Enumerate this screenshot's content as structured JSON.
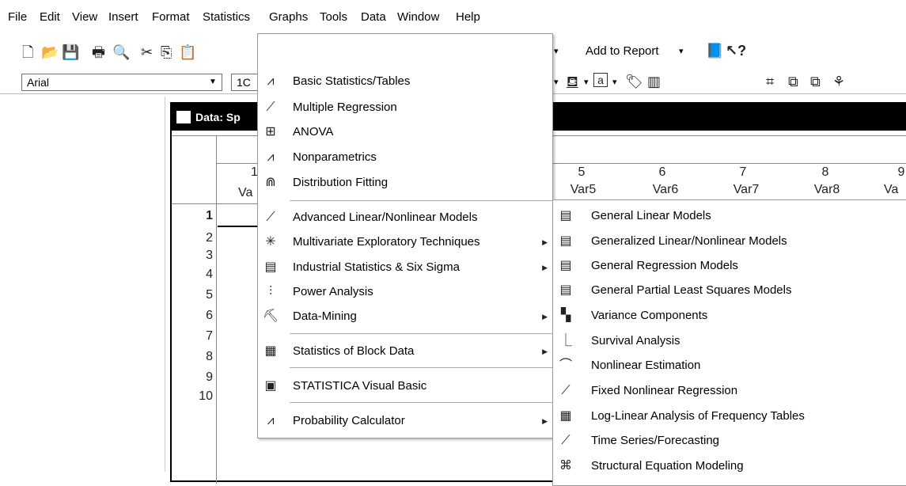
{
  "menubar": [
    "File",
    "Edit",
    "View",
    "Insert",
    "Format",
    "Statistics",
    "Graphs",
    "Tools",
    "Data",
    "Window",
    "Help"
  ],
  "toolbar": {
    "add_to_report": "Add to Report",
    "font_name": "Arial",
    "font_size": "1C"
  },
  "data_window": {
    "title": "Data: Sp",
    "col_first_header": "Va",
    "col_first_num": "1",
    "columns": [
      {
        "num": "5",
        "name": "Var5"
      },
      {
        "num": "6",
        "name": "Var6"
      },
      {
        "num": "7",
        "name": "Var7"
      },
      {
        "num": "8",
        "name": "Var8"
      },
      {
        "num": "9",
        "name": "Va"
      }
    ],
    "rows": [
      "1",
      "2",
      "3",
      "4",
      "5",
      "6",
      "7",
      "8",
      "9",
      "10"
    ]
  },
  "statistics_menu": [
    {
      "label": "Basic Statistics/Tables",
      "icon": "basic-stats-icon",
      "submenu": false
    },
    {
      "label": "Multiple Regression",
      "icon": "regression-icon",
      "submenu": false
    },
    {
      "label": "ANOVA",
      "icon": "anova-icon",
      "submenu": false
    },
    {
      "label": "Nonparametrics",
      "icon": "nonparametrics-icon",
      "submenu": false
    },
    {
      "label": "Distribution Fitting",
      "icon": "distribution-icon",
      "submenu": false
    },
    {
      "label": "Advanced Linear/Nonlinear Models",
      "icon": "advanced-models-icon",
      "submenu": true
    },
    {
      "label": "Multivariate Exploratory Techniques",
      "icon": "multivariate-icon",
      "submenu": true
    },
    {
      "label": "Industrial Statistics & Six Sigma",
      "icon": "industrial-icon",
      "submenu": true
    },
    {
      "label": "Power Analysis",
      "icon": "power-analysis-icon",
      "submenu": false
    },
    {
      "label": "Data-Mining",
      "icon": "data-mining-icon",
      "submenu": true
    },
    {
      "label": "Statistics of Block Data",
      "icon": "block-data-icon",
      "submenu": true
    },
    {
      "label": "STATISTICA Visual Basic",
      "icon": "visual-basic-icon",
      "submenu": false
    },
    {
      "label": "Probability Calculator",
      "icon": "probability-icon",
      "submenu": true
    }
  ],
  "advanced_submenu": [
    {
      "label": "General Linear Models",
      "icon": "glm-icon"
    },
    {
      "label": "Generalized Linear/Nonlinear Models",
      "icon": "glz-icon"
    },
    {
      "label": "General Regression Models",
      "icon": "grm-icon"
    },
    {
      "label": "General Partial Least Squares Models",
      "icon": "pls-icon"
    },
    {
      "label": "Variance Components",
      "icon": "variance-icon"
    },
    {
      "label": "Survival Analysis",
      "icon": "survival-icon"
    },
    {
      "label": "Nonlinear Estimation",
      "icon": "nonlinear-icon"
    },
    {
      "label": "Fixed Nonlinear Regression",
      "icon": "fixed-regression-icon"
    },
    {
      "label": "Log-Linear Analysis of Frequency Tables",
      "icon": "loglinear-icon"
    },
    {
      "label": "Time Series/Forecasting",
      "icon": "timeseries-icon"
    },
    {
      "label": "Structural Equation Modeling",
      "icon": "sem-icon"
    }
  ]
}
